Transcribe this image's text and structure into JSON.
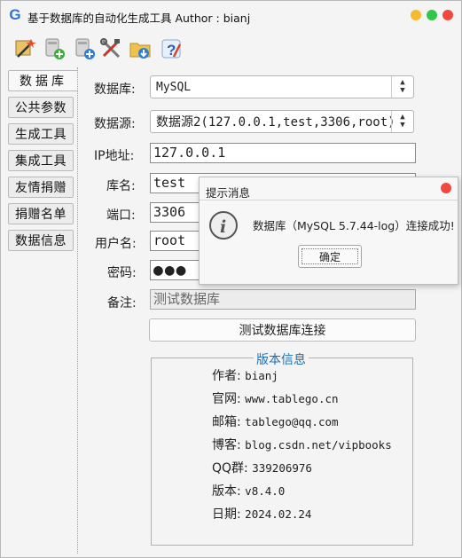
{
  "window": {
    "title": "基于数据库的自动化生成工具  Author : bianj"
  },
  "toolbar": {
    "icons": [
      "magic-wand-icon",
      "add-database-icon",
      "add-table-icon",
      "tools-icon",
      "folder-download-icon",
      "help-icon"
    ]
  },
  "sidebar": {
    "tabs": [
      {
        "label": "数据库",
        "active": true
      },
      {
        "label": "公共参数"
      },
      {
        "label": "生成工具"
      },
      {
        "label": "集成工具"
      },
      {
        "label": "友情捐赠"
      },
      {
        "label": "捐赠名单"
      },
      {
        "label": "数据信息"
      }
    ]
  },
  "form": {
    "db_type_label": "数据库:",
    "db_type_value": "MySQL",
    "datasource_label": "数据源:",
    "datasource_value": "数据源2(127.0.0.1,test,3306,root)",
    "ip_label": "IP地址:",
    "ip_value": "127.0.0.1",
    "dbname_label": "库名:",
    "dbname_value": "test",
    "port_label": "端口:",
    "port_value": "3306",
    "user_label": "用户名:",
    "user_value": "root",
    "password_label": "密码:",
    "password_mask": "●●●",
    "remark_label": "备注:",
    "remark_value": "测试数据库",
    "test_button": "测试数据库连接"
  },
  "version_info": {
    "title": "版本信息",
    "rows": [
      {
        "label": "作者:",
        "value": "bianj"
      },
      {
        "label": "官网:",
        "value": "www.tablego.cn"
      },
      {
        "label": "邮箱:",
        "value": "tablego@qq.com"
      },
      {
        "label": "博客:",
        "value": "blog.csdn.net/vipbooks"
      },
      {
        "label": "QQ群:",
        "value": "339206976"
      },
      {
        "label": "版本:",
        "value": "v8.4.0"
      },
      {
        "label": "日期:",
        "value": "2024.02.24"
      }
    ]
  },
  "dialog": {
    "title": "提示消息",
    "message": "数据库（MySQL 5.7.44-log）连接成功!",
    "ok_button": "确定",
    "icon": "info-icon"
  }
}
